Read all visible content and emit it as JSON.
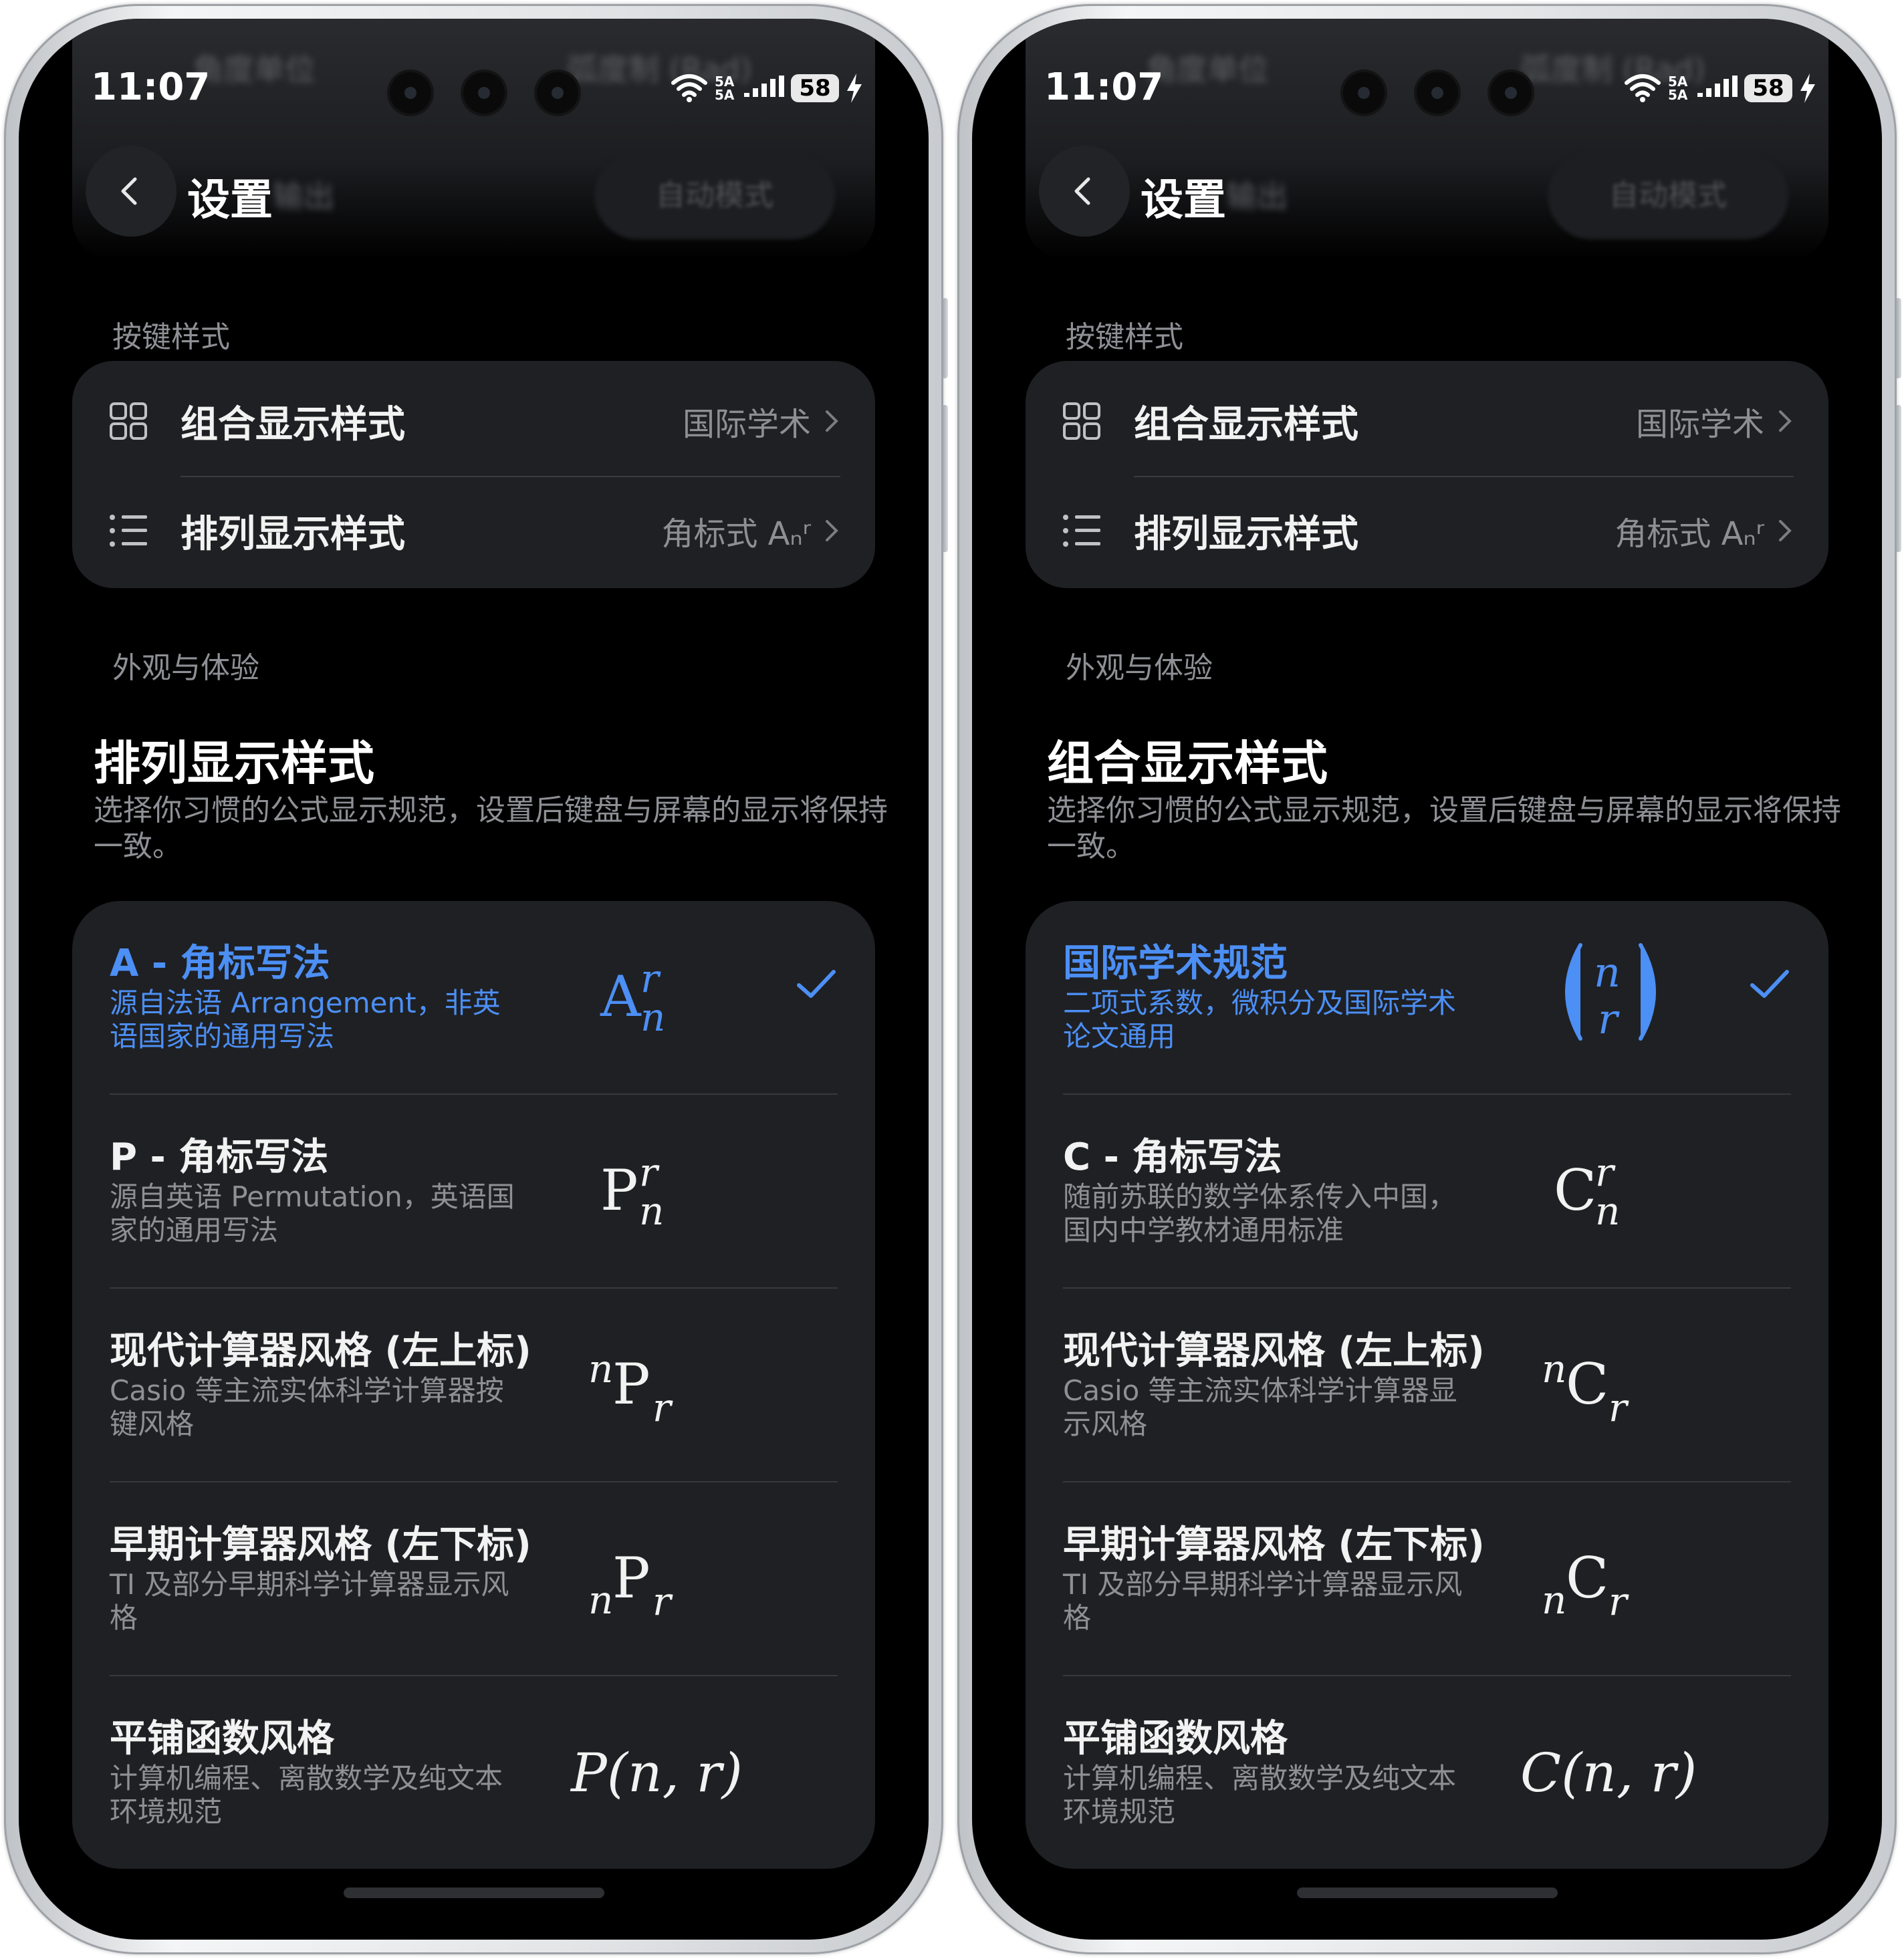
{
  "status": {
    "time": "11:07",
    "signal_label": "5A 5A",
    "battery": "58"
  },
  "blurred_bg": {
    "left_text": "角度单位",
    "right_text": "弧度制 (Rad)",
    "output_text": "输出",
    "mode": "自动模式"
  },
  "header": {
    "title": "设置"
  },
  "section_keys": {
    "label": "按键样式"
  },
  "settings_rows": [
    {
      "label": "组合显示样式",
      "value": "国际学术",
      "icon": "grid-icon"
    },
    {
      "label": "排列显示样式",
      "value": "角标式 Aₙʳ",
      "icon": "list-icon"
    }
  ],
  "section_appearance": {
    "label": "外观与体验"
  },
  "panels": [
    {
      "title": "排列显示样式",
      "desc": "选择你习惯的公式显示规范，设置后键盘与屏幕的显示将保持一致。",
      "options": [
        {
          "title": "A - 角标写法",
          "sub": "源自法语 Arrangement，非英语国家的通用写法",
          "selected": true
        },
        {
          "title": "P - 角标写法",
          "sub": "源自英语 Permutation，英语国家的通用写法",
          "selected": false
        },
        {
          "title": "现代计算器风格 (左上标)",
          "sub": "Casio 等主流实体科学计算器按键风格",
          "selected": false
        },
        {
          "title": "早期计算器风格 (左下标)",
          "sub": "TI 及部分早期科学计算器显示风格",
          "selected": false
        },
        {
          "title": "平铺函数风格",
          "sub": "计算机编程、离散数学及纯文本环境规范",
          "selected": false
        }
      ]
    },
    {
      "title": "组合显示样式",
      "desc": "选择你习惯的公式显示规范，设置后键盘与屏幕的显示将保持一致。",
      "options": [
        {
          "title": "国际学术规范",
          "sub": "二项式系数，微积分及国际学术论文通用",
          "selected": true
        },
        {
          "title": "C - 角标写法",
          "sub": "随前苏联的数学体系传入中国，国内中学教材通用标准",
          "selected": false
        },
        {
          "title": "现代计算器风格 (左上标)",
          "sub": "Casio 等主流实体科学计算器显示风格",
          "selected": false
        },
        {
          "title": "早期计算器风格 (左下标)",
          "sub": "TI 及部分早期科学计算器显示风格",
          "selected": false
        },
        {
          "title": "平铺函数风格",
          "sub": "计算机编程、离散数学及纯文本环境规范",
          "selected": false
        }
      ]
    }
  ],
  "formulas": {
    "letter_A": "A",
    "letter_P": "P",
    "letter_C": "C",
    "sup": "r",
    "sub": "n",
    "tiled_P": "P(n, r)",
    "tiled_C": "C(n, r)"
  },
  "colors": {
    "accent": "#4c8ff5",
    "card": "#1f2023",
    "muted": "#8e9095"
  }
}
